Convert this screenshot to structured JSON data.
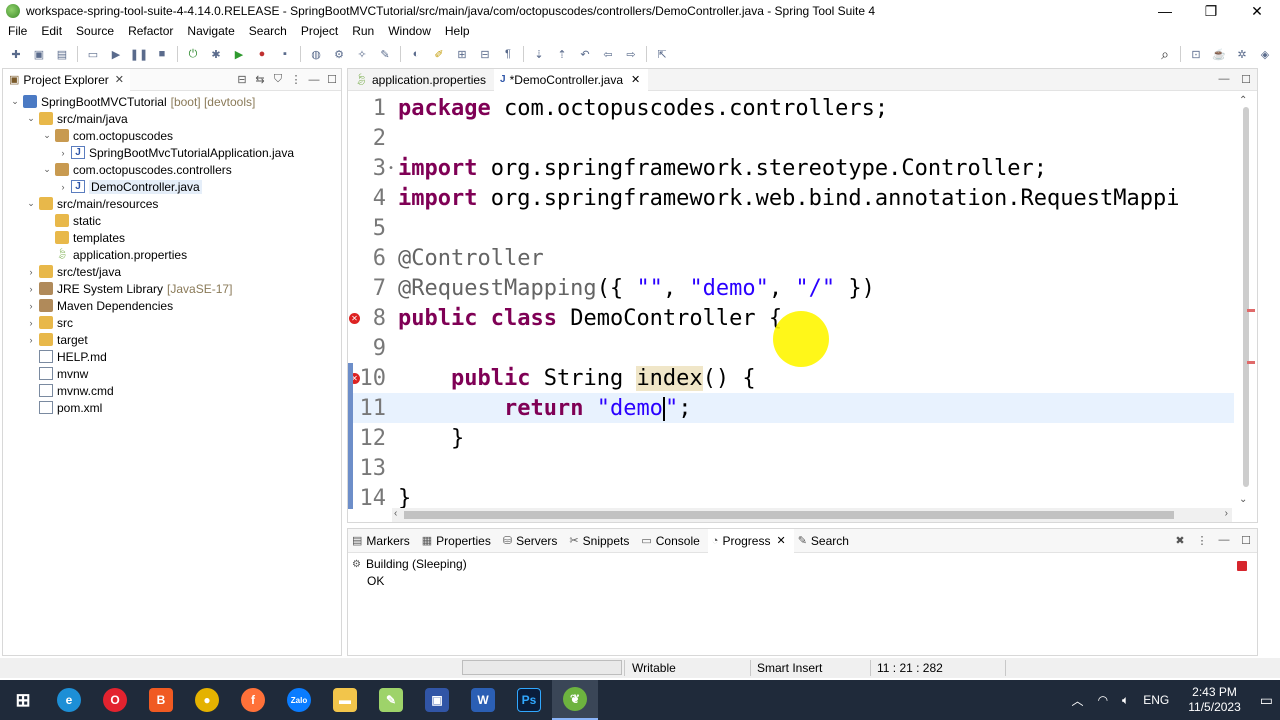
{
  "window": {
    "title": "workspace-spring-tool-suite-4-4.14.0.RELEASE - SpringBootMVCTutorial/src/main/java/com/octopuscodes/controllers/DemoController.java - Spring Tool Suite 4",
    "minimize": "—",
    "restore": "❐",
    "close": "✕"
  },
  "menu": [
    "File",
    "Edit",
    "Source",
    "Refactor",
    "Navigate",
    "Search",
    "Project",
    "Run",
    "Window",
    "Help"
  ],
  "explorer": {
    "tab_label": "Project Explorer",
    "close": "✕",
    "tree": [
      {
        "label": "SpringBootMVCTutorial",
        "suffix": "[boot] [devtools]",
        "depth": 0,
        "arrow": "⌄",
        "icon": "project-icon"
      },
      {
        "label": "src/main/java",
        "suffix": "",
        "depth": 1,
        "arrow": "⌄",
        "icon": "source-folder-icon"
      },
      {
        "label": "com.octopuscodes",
        "suffix": "",
        "depth": 2,
        "arrow": "⌄",
        "icon": "package-icon"
      },
      {
        "label": "SpringBootMvcTutorialApplication.java",
        "suffix": "",
        "depth": 3,
        "arrow": "›",
        "icon": "java-file-icon"
      },
      {
        "label": "com.octopuscodes.controllers",
        "suffix": "",
        "depth": 2,
        "arrow": "⌄",
        "icon": "package-icon"
      },
      {
        "label": "DemoController.java",
        "suffix": "",
        "depth": 3,
        "arrow": "›",
        "icon": "java-file-icon",
        "selected": true
      },
      {
        "label": "src/main/resources",
        "suffix": "",
        "depth": 1,
        "arrow": "⌄",
        "icon": "source-folder-icon"
      },
      {
        "label": "static",
        "suffix": "",
        "depth": 2,
        "arrow": "",
        "icon": "folder-icon"
      },
      {
        "label": "templates",
        "suffix": "",
        "depth": 2,
        "arrow": "",
        "icon": "folder-icon"
      },
      {
        "label": "application.properties",
        "suffix": "",
        "depth": 2,
        "arrow": "",
        "icon": "properties-file-icon"
      },
      {
        "label": "src/test/java",
        "suffix": "",
        "depth": 1,
        "arrow": "›",
        "icon": "source-folder-icon"
      },
      {
        "label": "JRE System Library",
        "suffix": "[JavaSE-17]",
        "depth": 1,
        "arrow": "›",
        "icon": "library-icon"
      },
      {
        "label": "Maven Dependencies",
        "suffix": "",
        "depth": 1,
        "arrow": "›",
        "icon": "library-icon"
      },
      {
        "label": "src",
        "suffix": "",
        "depth": 1,
        "arrow": "›",
        "icon": "folder-icon"
      },
      {
        "label": "target",
        "suffix": "",
        "depth": 1,
        "arrow": "›",
        "icon": "folder-icon"
      },
      {
        "label": "HELP.md",
        "suffix": "",
        "depth": 1,
        "arrow": "",
        "icon": "file-icon"
      },
      {
        "label": "mvnw",
        "suffix": "",
        "depth": 1,
        "arrow": "",
        "icon": "file-icon"
      },
      {
        "label": "mvnw.cmd",
        "suffix": "",
        "depth": 1,
        "arrow": "",
        "icon": "file-icon"
      },
      {
        "label": "pom.xml",
        "suffix": "",
        "depth": 1,
        "arrow": "",
        "icon": "file-icon"
      }
    ]
  },
  "editor": {
    "tabs": [
      {
        "label": "application.properties",
        "active": false,
        "closable": false
      },
      {
        "label": "*DemoController.java",
        "active": true,
        "closable": true
      }
    ],
    "lines": [
      {
        "n": "1",
        "tokens": [
          [
            "kw",
            "package"
          ],
          [
            "",
            " com.octopuscodes.controllers;"
          ]
        ]
      },
      {
        "n": "2",
        "tokens": []
      },
      {
        "n": "3",
        "fold": true,
        "tokens": [
          [
            "kw",
            "import"
          ],
          [
            "",
            " org.springframework.stereotype.Controller;"
          ]
        ]
      },
      {
        "n": "4",
        "tokens": [
          [
            "kw",
            "import"
          ],
          [
            "",
            " org.springframework.web.bind.annotation.RequestMappi"
          ]
        ]
      },
      {
        "n": "5",
        "tokens": []
      },
      {
        "n": "6",
        "tokens": [
          [
            "ann",
            "@Controller"
          ]
        ]
      },
      {
        "n": "7",
        "tokens": [
          [
            "ann",
            "@RequestMapping"
          ],
          [
            "",
            "({ "
          ],
          [
            "str",
            "\"\""
          ],
          [
            "",
            ", "
          ],
          [
            "str",
            "\"demo\""
          ],
          [
            "",
            ", "
          ],
          [
            "str",
            "\"/\""
          ],
          [
            "",
            " })"
          ]
        ]
      },
      {
        "n": "8",
        "error": true,
        "tokens": [
          [
            "kw",
            "public"
          ],
          [
            "",
            " "
          ],
          [
            "kw",
            "class"
          ],
          [
            "",
            " DemoController {"
          ]
        ]
      },
      {
        "n": "9",
        "tokens": []
      },
      {
        "n": "10",
        "error": true,
        "tokens": [
          [
            "",
            "    "
          ],
          [
            "kw",
            "public"
          ],
          [
            "",
            " String "
          ],
          [
            "hl",
            "index"
          ],
          [
            "",
            "() {"
          ]
        ]
      },
      {
        "n": "11",
        "current": true,
        "tokens": [
          [
            "",
            "        "
          ],
          [
            "kw",
            "return"
          ],
          [
            "",
            " "
          ],
          [
            "str",
            "\"demo"
          ],
          [
            "caret",
            ""
          ],
          [
            "str",
            "\""
          ],
          [
            "",
            ";"
          ]
        ]
      },
      {
        "n": "12",
        "tokens": [
          [
            "",
            "    }"
          ]
        ]
      },
      {
        "n": "13",
        "tokens": []
      },
      {
        "n": "14",
        "tokens": [
          [
            "",
            "}"
          ]
        ]
      }
    ]
  },
  "bottom_panel": {
    "tabs": [
      {
        "label": "Markers",
        "icon": "markers-icon",
        "active": false
      },
      {
        "label": "Properties",
        "icon": "properties-icon",
        "active": false
      },
      {
        "label": "Servers",
        "icon": "servers-icon",
        "active": false
      },
      {
        "label": "Snippets",
        "icon": "snippets-icon",
        "active": false
      },
      {
        "label": "Console",
        "icon": "console-icon",
        "active": false
      },
      {
        "label": "Progress",
        "icon": "progress-icon",
        "active": true
      },
      {
        "label": "Search",
        "icon": "search-icon",
        "active": false
      }
    ],
    "job_name": "Building (Sleeping)",
    "job_status": "OK"
  },
  "statusbar": {
    "writable": "Writable",
    "insert_mode": "Smart Insert",
    "position": "11 : 21 : 282"
  },
  "taskbar": {
    "apps": [
      "windows-start",
      "edge",
      "opera",
      "brave",
      "chrome",
      "firefox",
      "zalo",
      "file-explorer",
      "notepad-plus-plus",
      "save",
      "word",
      "photoshop",
      "spring-tool-suite"
    ],
    "language": "ENG",
    "time": "2:43 PM",
    "date": "11/5/2023"
  }
}
